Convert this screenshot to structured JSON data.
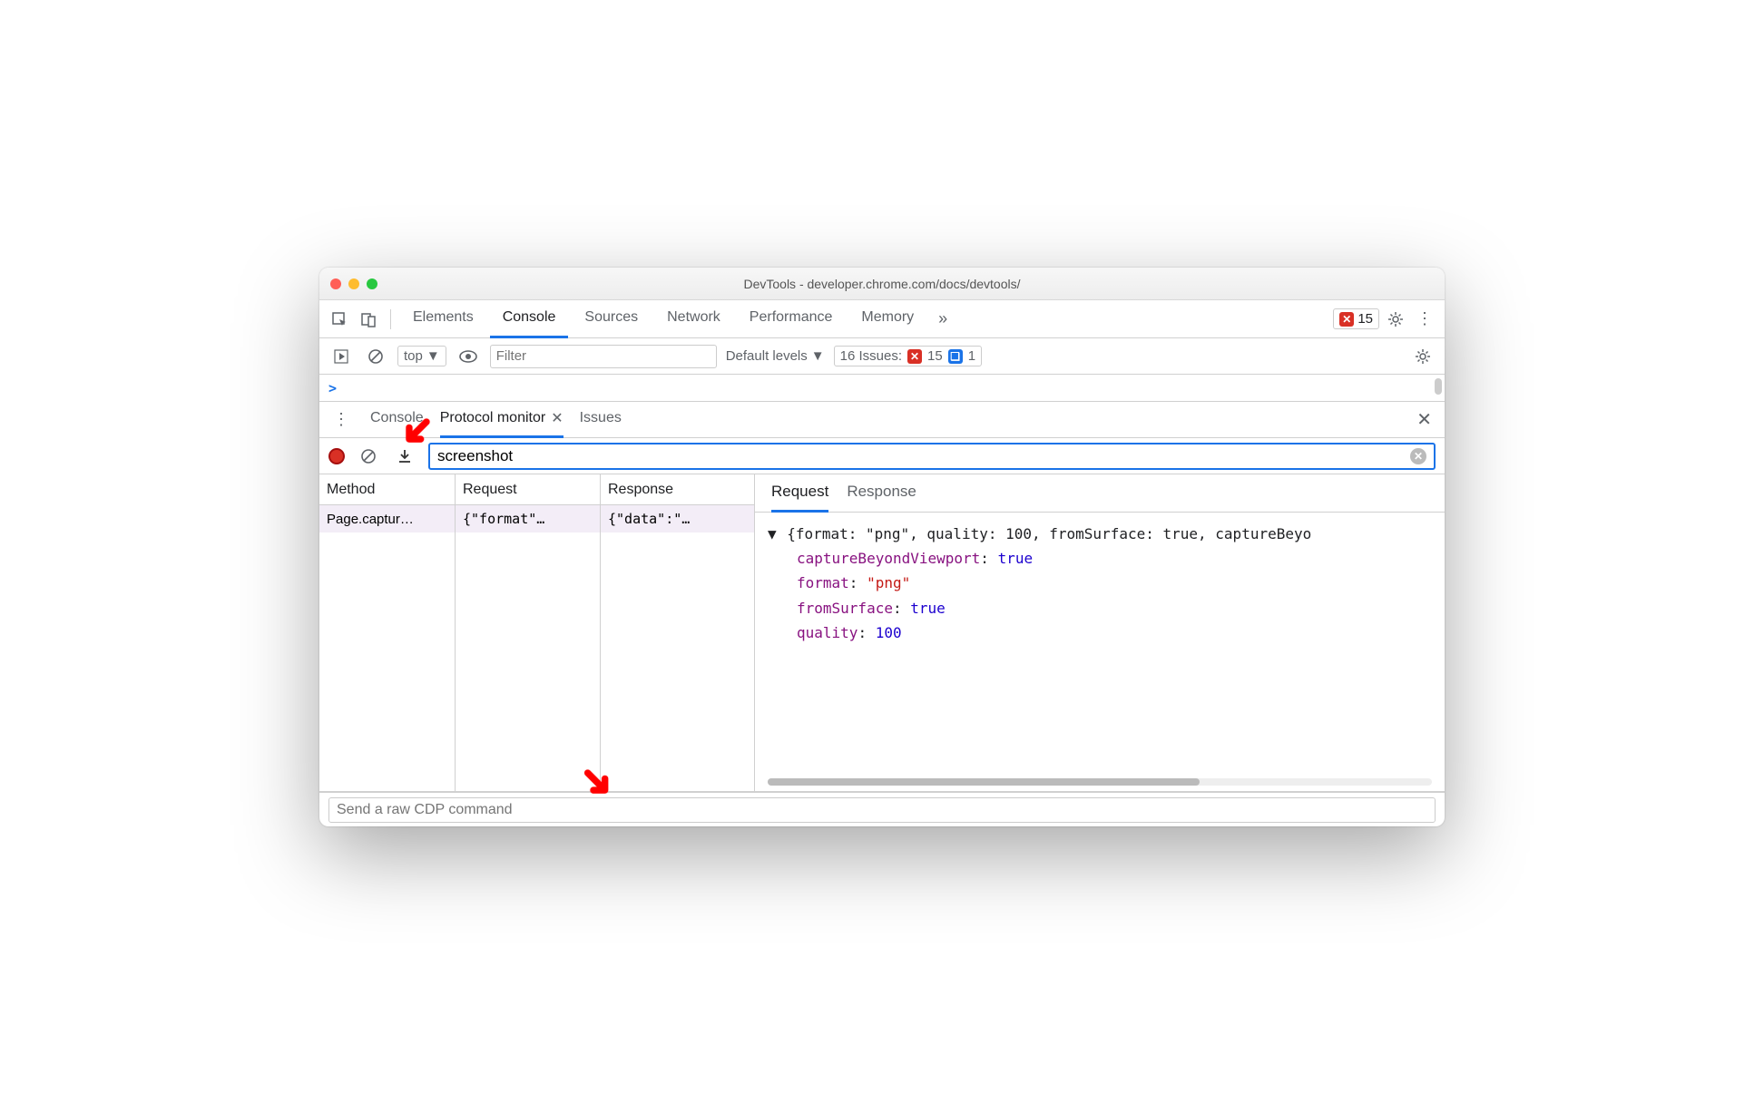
{
  "window": {
    "title": "DevTools - developer.chrome.com/docs/devtools/"
  },
  "tabs": {
    "items": [
      "Elements",
      "Console",
      "Sources",
      "Network",
      "Performance",
      "Memory"
    ],
    "active": "Console",
    "error_count": "15"
  },
  "console_toolbar": {
    "context": "top",
    "filter_placeholder": "Filter",
    "levels": "Default levels",
    "issues_label": "16 Issues:",
    "issues_err": "15",
    "issues_info": "1"
  },
  "console_prompt": ">",
  "drawer": {
    "tabs": [
      "Console",
      "Protocol monitor",
      "Issues"
    ],
    "active": "Protocol monitor"
  },
  "protocol": {
    "filter_value": "screenshot",
    "columns": [
      "Method",
      "Request",
      "Response"
    ],
    "row": {
      "method": "Page.captur…",
      "request": "{\"format\"…",
      "response": "{\"data\":\"…"
    },
    "detail_tabs": [
      "Request",
      "Response"
    ],
    "detail_active": "Request",
    "json_header": "{format: \"png\", quality: 100, fromSurface: true, captureBeyo",
    "json_rows": [
      {
        "key": "captureBeyondViewport",
        "val": "true",
        "type": "b"
      },
      {
        "key": "format",
        "val": "\"png\"",
        "type": "s"
      },
      {
        "key": "fromSurface",
        "val": "true",
        "type": "b"
      },
      {
        "key": "quality",
        "val": "100",
        "type": "n"
      }
    ],
    "cdp_placeholder": "Send a raw CDP command"
  }
}
